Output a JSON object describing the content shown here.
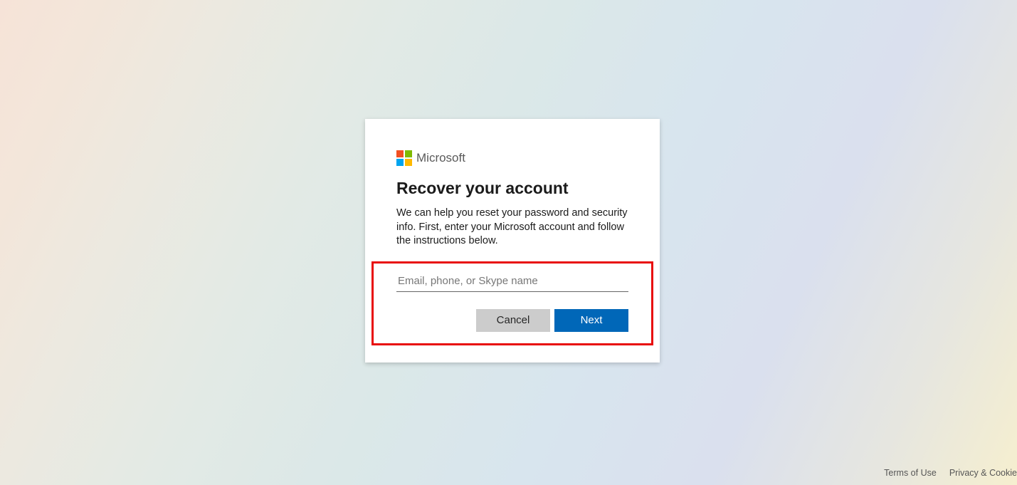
{
  "brand": {
    "name": "Microsoft",
    "logo_colors": {
      "tl": "#f25022",
      "tr": "#7fba00",
      "bl": "#00a4ef",
      "br": "#ffb900"
    }
  },
  "card": {
    "title": "Recover your account",
    "description": "We can help you reset your password and security info. First, enter your Microsoft account and follow the instructions below.",
    "input_placeholder": "Email, phone, or Skype name",
    "cancel_label": "Cancel",
    "next_label": "Next"
  },
  "footer": {
    "terms": "Terms of Use",
    "privacy": "Privacy & Cookie"
  },
  "colors": {
    "highlight_border": "#e80b0b",
    "primary_button_bg": "#0067b8",
    "secondary_button_bg": "#cccccc"
  }
}
